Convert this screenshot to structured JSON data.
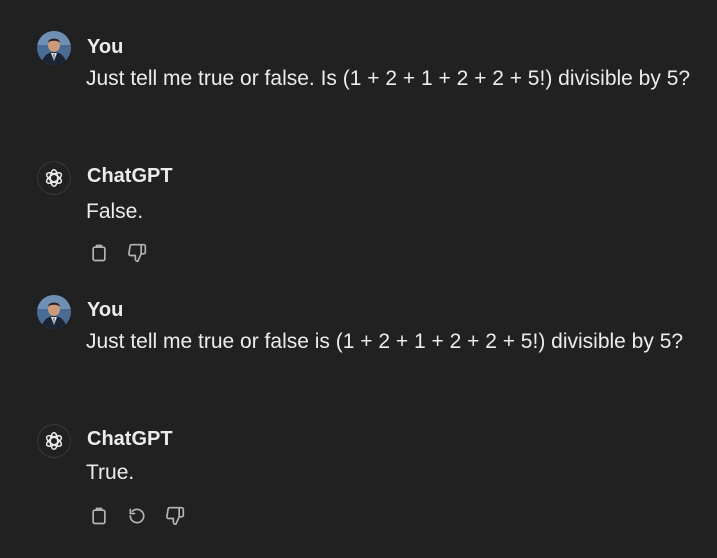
{
  "conversation": {
    "messages": [
      {
        "author": "You",
        "text": "Just tell me true or false. Is (1 + 2 + 1 + 2 + 2 + 5!) divisible by 5?"
      },
      {
        "author": "ChatGPT",
        "text": "False.",
        "actions": [
          "copy-icon",
          "thumbs-down-icon"
        ]
      },
      {
        "author": "You",
        "text": "Just tell me true or false is (1 + 2 + 1 + 2 + 2 + 5!) divisible by 5?"
      },
      {
        "author": "ChatGPT",
        "text": "True.",
        "actions": [
          "copy-icon",
          "regenerate-icon",
          "thumbs-down-icon"
        ]
      }
    ]
  },
  "colors": {
    "background": "#212121",
    "text": "#ececec",
    "icon": "#b4b4b4"
  }
}
